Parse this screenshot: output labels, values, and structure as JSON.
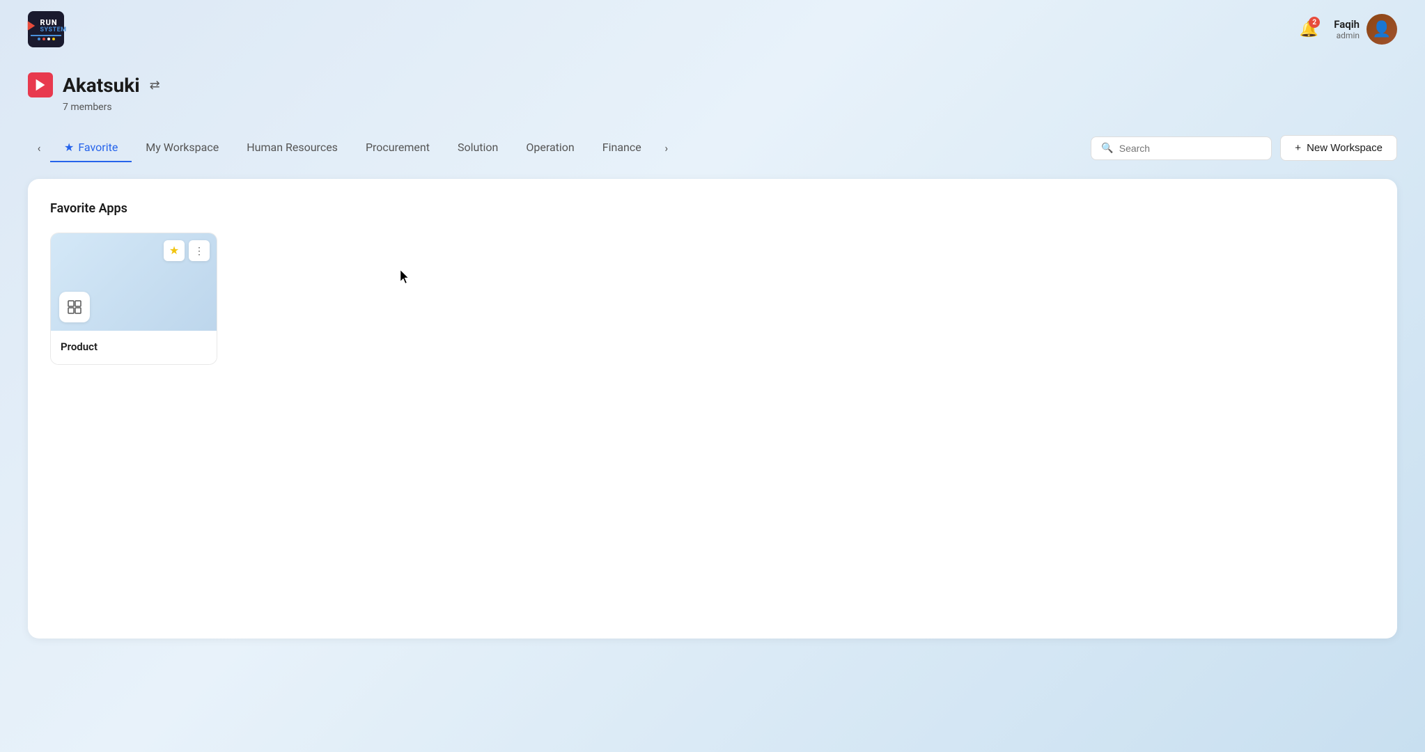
{
  "header": {
    "logo": {
      "run_text": "RUN",
      "system_text": "SYSTEM"
    },
    "notification": {
      "count": "2"
    },
    "user": {
      "name": "Faqih",
      "role": "admin"
    }
  },
  "workspace": {
    "icon": "🔴",
    "title": "Akatsuki",
    "members": "7 members"
  },
  "nav": {
    "tabs": [
      {
        "label": "Favorite",
        "active": true,
        "has_star": true
      },
      {
        "label": "My Workspace",
        "active": false
      },
      {
        "label": "Human Resources",
        "active": false
      },
      {
        "label": "Procurement",
        "active": false
      },
      {
        "label": "Solution",
        "active": false
      },
      {
        "label": "Operation",
        "active": false
      },
      {
        "label": "Finance",
        "active": false
      }
    ],
    "search_placeholder": "Search",
    "new_workspace_label": "New Workspace"
  },
  "main": {
    "section_title": "Favorite Apps",
    "apps": [
      {
        "name": "Product",
        "starred": true
      }
    ]
  }
}
